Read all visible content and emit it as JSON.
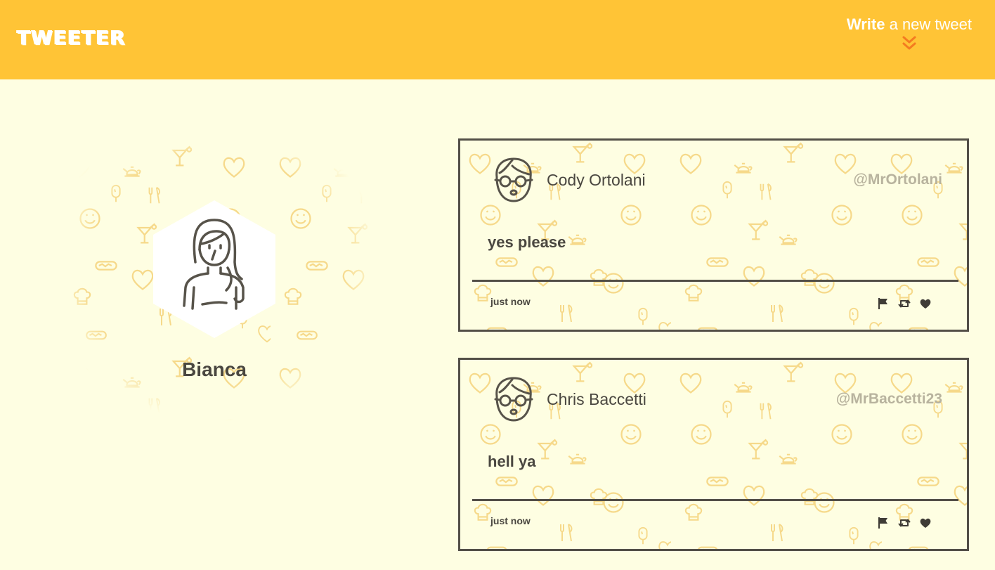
{
  "header": {
    "brand": "TWEETER",
    "compose_bold": "Write",
    "compose_rest": " a new tweet",
    "background": "#ffc436",
    "accent": "#f47b20"
  },
  "profile": {
    "name": "Bianca",
    "avatar_icon": "woman-avatar-icon"
  },
  "tweets": [
    {
      "name": "Cody Ortolani",
      "handle": "@MrOrtolani",
      "content": "yes please",
      "time": "just now",
      "avatar_icon": "man-glasses-avatar-icon"
    },
    {
      "name": "Chris Baccetti",
      "handle": "@MrBaccetti23",
      "content": "hell ya",
      "time": "just now",
      "avatar_icon": "man-glasses-avatar-icon"
    }
  ],
  "colors": {
    "page_background": "#fefee2",
    "pattern": "#f6d98a",
    "border": "#534f47",
    "handle": "#b8b39e"
  }
}
